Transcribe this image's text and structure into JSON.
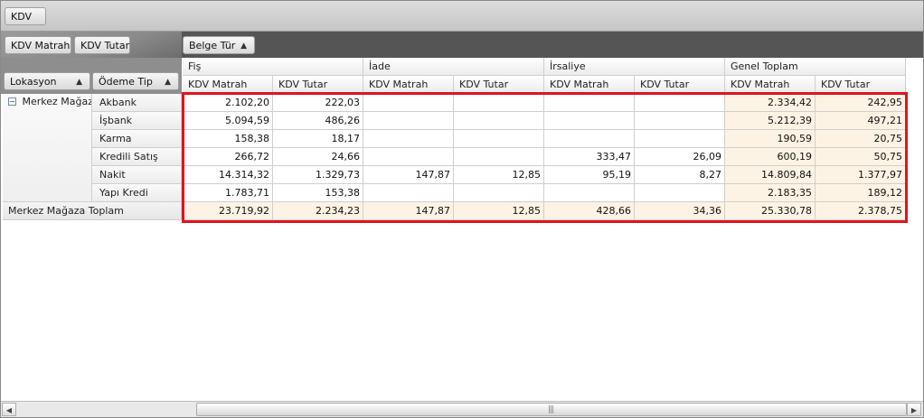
{
  "filter_field": {
    "label": "KDV"
  },
  "data_fields": [
    {
      "label": "KDV Matrah"
    },
    {
      "label": "KDV Tutar"
    }
  ],
  "column_field": {
    "label": "Belge Tür",
    "sort": "▲"
  },
  "row_fields": [
    {
      "label": "Lokasyon",
      "sort": "▲"
    },
    {
      "label": "Ödeme Tip",
      "sort": "▲"
    }
  ],
  "column_groups": [
    {
      "label": "Fiş"
    },
    {
      "label": "İade"
    },
    {
      "label": "İrsaliye"
    },
    {
      "label": "Genel Toplam"
    }
  ],
  "measures": [
    "KDV Matrah",
    "KDV Tutar",
    "KDV Matrah",
    "KDV Tutar",
    "KDV Matrah",
    "KDV Tutar",
    "KDV Matrah",
    "KDV Tutar"
  ],
  "group": {
    "label": "Merkez Mağaza",
    "collapse_glyph": "−",
    "total_label": "Merkez Mağaza Toplam"
  },
  "rows": [
    {
      "label": "Akbank",
      "cells": [
        "2.102,20",
        "222,03",
        "",
        "",
        "",
        "",
        "2.334,42",
        "242,95"
      ]
    },
    {
      "label": "İşbank",
      "cells": [
        "5.094,59",
        "486,26",
        "",
        "",
        "",
        "",
        "5.212,39",
        "497,21"
      ]
    },
    {
      "label": "Karma",
      "cells": [
        "158,38",
        "18,17",
        "",
        "",
        "",
        "",
        "190,59",
        "20,75"
      ]
    },
    {
      "label": "Kredili Satış",
      "cells": [
        "266,72",
        "24,66",
        "",
        "",
        "333,47",
        "26,09",
        "600,19",
        "50,75"
      ]
    },
    {
      "label": "Nakit",
      "cells": [
        "14.314,32",
        "1.329,73",
        "147,87",
        "12,85",
        "95,19",
        "8,27",
        "14.809,84",
        "1.377,97"
      ]
    },
    {
      "label": "Yapı Kredi",
      "cells": [
        "1.783,71",
        "153,38",
        "",
        "",
        "",
        "",
        "2.183,35",
        "189,12"
      ]
    }
  ],
  "totals": [
    "23.719,92",
    "2.234,23",
    "147,87",
    "12,85",
    "428,66",
    "34,36",
    "25.330,78",
    "2.378,75"
  ],
  "scrollbar": {
    "left_arrow": "◀",
    "right_arrow": "▶",
    "grip": "|||"
  },
  "colors": {
    "highlight": "#e0141e",
    "grand_total_bg": "#fdf3e4"
  }
}
